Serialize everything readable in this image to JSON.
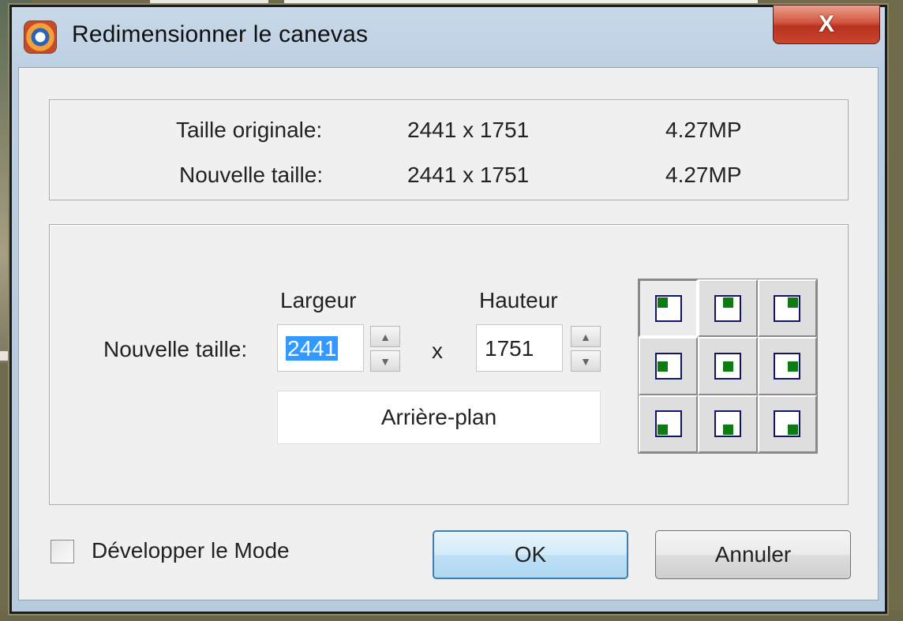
{
  "window": {
    "title": "Redimensionner le canevas",
    "close_label": "X"
  },
  "info": {
    "original": {
      "label": "Taille originale:",
      "dims": "2441 x 1751",
      "mp": "4.27MP"
    },
    "new": {
      "label": "Nouvelle taille:",
      "dims": "2441 x 1751",
      "mp": "4.27MP"
    }
  },
  "resize": {
    "row_label": "Nouvelle taille:",
    "width_label": "Largeur",
    "height_label": "Hauteur",
    "width_value": "2441",
    "height_value": "1751",
    "times": "x",
    "background_button": "Arrière-plan",
    "spin_up": "▲",
    "spin_down": "▼"
  },
  "footer": {
    "checkbox_label": "Développer le Mode",
    "checkbox_checked": false,
    "ok": "OK",
    "cancel": "Annuler"
  },
  "anchor": {
    "selected": "top-left"
  }
}
